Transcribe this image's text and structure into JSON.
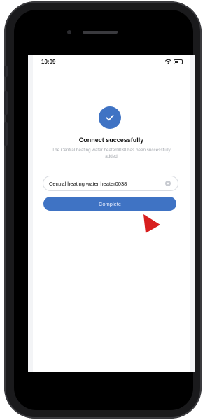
{
  "status_bar": {
    "time": "10:09",
    "signal_dots": "....",
    "icons": [
      "wifi-icon",
      "battery-icon"
    ]
  },
  "result": {
    "icon": "checkmark-icon",
    "title": "Connect successfully",
    "message": "The Central heating water heater0038 has been successfully added"
  },
  "device_name": {
    "value": "Central heating water heater0038",
    "clear_icon": "clear-icon"
  },
  "actions": {
    "complete_label": "Complete"
  },
  "overlay": {
    "pointer_icon": "red-arrow-pointer-icon"
  },
  "colors": {
    "accent": "#3f73c4",
    "pointer": "#d81e1e",
    "muted_text": "#a3a7ad"
  }
}
